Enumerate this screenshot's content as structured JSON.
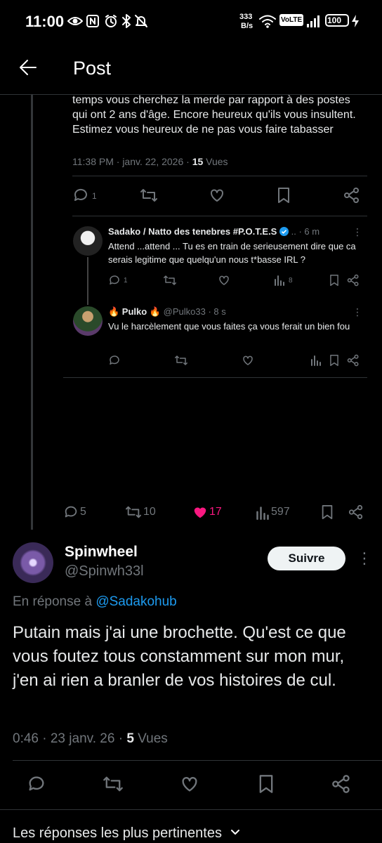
{
  "status_bar": {
    "time": "11:00",
    "net_speed_value": "333",
    "net_speed_unit": "B/s",
    "volte": "VoLTE",
    "battery": "100"
  },
  "header": {
    "title": "Post"
  },
  "quoted_post": {
    "text": "temps vous cherchez la merde par rapport à des postes qui ont 2 ans d'âge. Encore heureux qu'ils vous insultent. Estimez vous heureux de ne pas vous faire tabasser",
    "time": "11:38 PM · janv. 22, 2026 · ",
    "views_count": "15",
    "views_label": " Vues",
    "reply_count": "1"
  },
  "replies": [
    {
      "name": "Sadako / Natto des tenebres #P.O.T.E.S",
      "ellipsis": "..",
      "age": "· 6 m",
      "text": "Attend ...attend ... Tu es en train de serieusement dire que ca serais legitime que quelqu'un nous t*basse IRL ?",
      "reply_count": "1",
      "view_count": "8"
    },
    {
      "name": "🔥 Pulko 🔥",
      "handle": "@Pulko33",
      "age": "· 8 s",
      "text": "Vu le harcèlement que vous faites ça vous ferait un bien fou"
    }
  ],
  "image_stats": {
    "replies": "5",
    "reposts": "10",
    "likes": "17",
    "views": "597"
  },
  "main_post": {
    "name": "Spinwheel",
    "handle": "@Spinwh33l",
    "follow_label": "Suivre",
    "reply_prefix": "En réponse à ",
    "reply_to": "@Sadakohub",
    "text": "Putain mais j'ai une brochette. Qu'est ce que vous foutez tous constamment sur mon mur, j'en ai rien a branler de vos histoires de cul.",
    "time": "0:46 · 23 janv. 26 · ",
    "views_count": "5",
    "views_label": " Vues"
  },
  "footer": {
    "sort_label": "Les réponses les plus pertinentes"
  },
  "colors": {
    "accent": "#1d9bf0",
    "like": "#f91880",
    "background": "#000000"
  }
}
